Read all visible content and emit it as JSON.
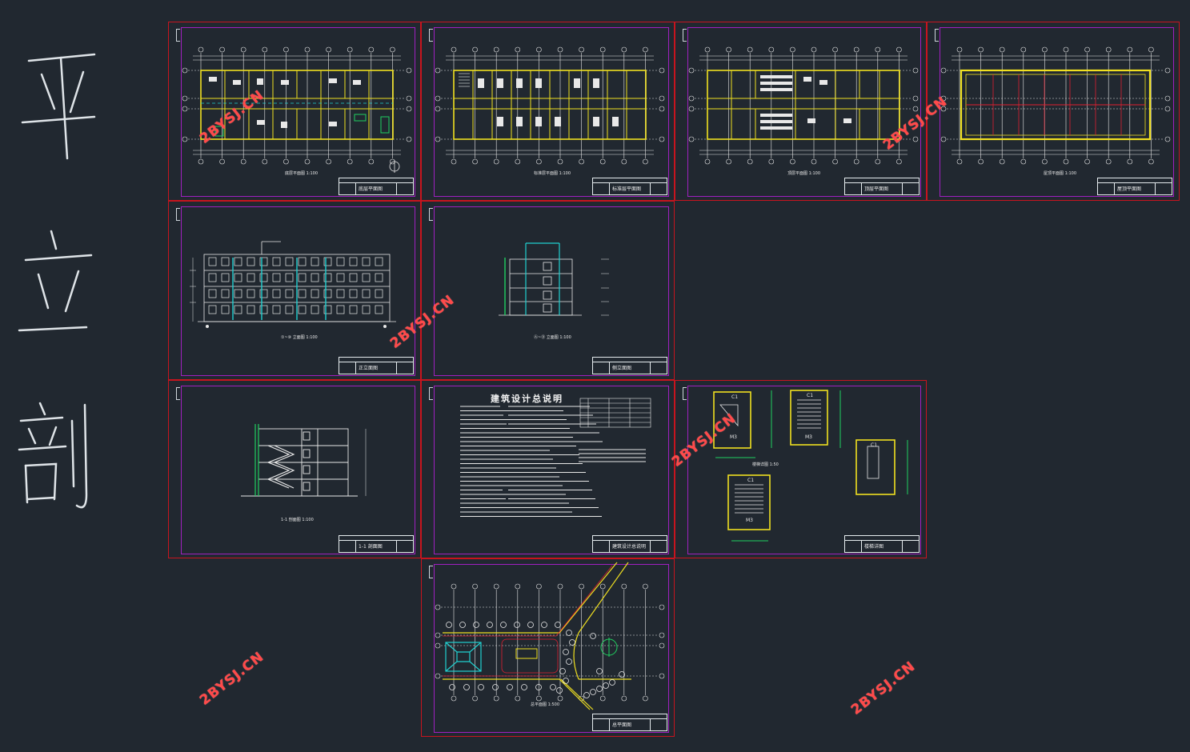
{
  "handwriting": {
    "ping": "平",
    "li": "立",
    "pou": "剖"
  },
  "watermark": "2BYSJ.CN",
  "notes_title": "建筑设计总说明",
  "colors": {
    "background": "#212830",
    "sheet_border": "#c8141e",
    "inner_border": "#a020c0",
    "wall": "#f0e020",
    "axis": "#e8e8e8",
    "watermark": "#ff4a4a",
    "green": "#20d060",
    "cyan": "#20d0d0"
  },
  "sheets": [
    {
      "id": "plan-1",
      "caption": "底层平面图 1:100",
      "title": "底层平面图"
    },
    {
      "id": "plan-2",
      "caption": "标准层平面图 1:100",
      "title": "标准层平面图"
    },
    {
      "id": "plan-3",
      "caption": "顶层平面图 1:100",
      "title": "顶层平面图"
    },
    {
      "id": "plan-roof",
      "caption": "屋顶平面图 1:100",
      "title": "屋顶平面图"
    },
    {
      "id": "elev-front",
      "caption": "①~⑩ 立面图 1:100",
      "title": "正立面图"
    },
    {
      "id": "elev-side",
      "caption": "Ⓐ~Ⓓ 立面图 1:100",
      "title": "侧立面图"
    },
    {
      "id": "section",
      "caption": "1-1 剖面图 1:100",
      "title": "1-1 剖面图"
    },
    {
      "id": "notes",
      "caption": "",
      "title": "建筑设计总说明"
    },
    {
      "id": "details",
      "caption": "楼梯详图 1:50",
      "title": "楼梯详图"
    },
    {
      "id": "site",
      "caption": "总平面图 1:500",
      "title": "总平面图"
    }
  ]
}
